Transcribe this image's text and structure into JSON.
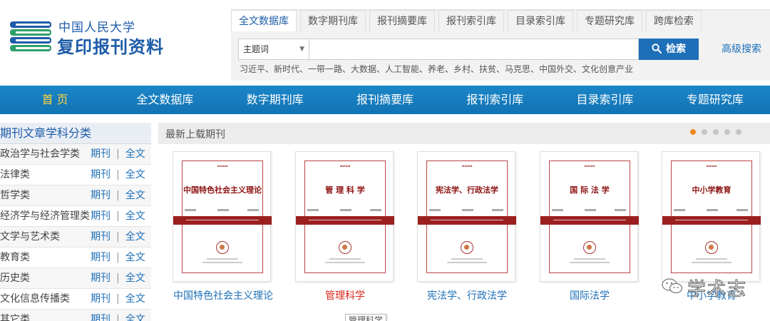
{
  "header": {
    "logo_small": "中国人民大学",
    "logo_big": "复印报刊资料"
  },
  "search": {
    "tabs": [
      "全文数据库",
      "数字期刊库",
      "报刊摘要库",
      "报刊索引库",
      "目录索引库",
      "专题研究库",
      "跨库检索"
    ],
    "scope_value": "主题词",
    "query_value": "",
    "button_label": "检索",
    "advanced_label": "高级搜索",
    "hot_words": "习近平、新时代、一带一路、大数据、人工智能、养老、乡村、扶贫、马克思、中国外交、文化创意产业"
  },
  "nav": {
    "items": [
      "首 页",
      "全文数据库",
      "数字期刊库",
      "报刊摘要库",
      "报刊索引库",
      "目录索引库",
      "专题研究库"
    ]
  },
  "sidebar": {
    "title": "期刊文章学科分类",
    "link_periodical": "期刊",
    "link_fulltext": "全文",
    "separator": "|",
    "categories": [
      "政治学与社会学类",
      "法律类",
      "哲学类",
      "经济学与经济管理类",
      "文学与艺术类",
      "教育类",
      "历史类",
      "文化信息传播类",
      "其它类"
    ]
  },
  "main": {
    "title": "最新上载期刊",
    "tooltip": "管理科学",
    "covers": [
      {
        "cover_title": "中国特色社会主义理论",
        "label": "中国特色社会主义理论"
      },
      {
        "cover_title": "管 理 科 学",
        "label": "管理科学"
      },
      {
        "cover_title": "宪法学、行政法学",
        "label": "宪法学、行政法学"
      },
      {
        "cover_title": "国 际 法 学",
        "label": "国际法学"
      },
      {
        "cover_title": "中小学教育",
        "label": "中小学教育"
      }
    ]
  },
  "watermark": {
    "text": "学术志"
  },
  "colors": {
    "brand_blue": "#1d5ca8",
    "nav_blue": "#1273b3",
    "home_yellow": "#ffd23c",
    "cover_red": "#9b1f1f",
    "active_dot": "#f08a1d",
    "link_red": "#d9261c"
  },
  "icons": {
    "search_button": "magnifier-icon",
    "logo": "stacked-books-icon",
    "watermark": "wechat-icon"
  }
}
